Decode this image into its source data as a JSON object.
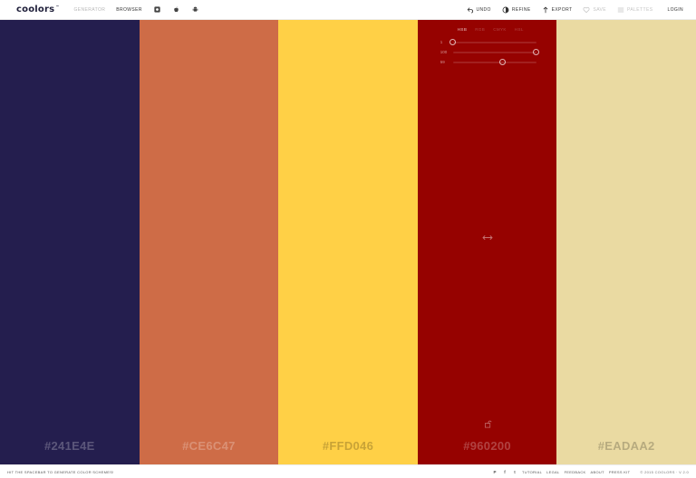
{
  "header": {
    "logo": "coolors",
    "logo_mark": "™",
    "nav": {
      "generator": "GENERATOR",
      "browser": "BROWSER"
    },
    "platform_icons": [
      "chrome-icon",
      "apple-icon",
      "android-icon"
    ],
    "actions": {
      "undo": "UNDO",
      "refine": "REFINE",
      "export": "EXPORT",
      "save": "SAVE",
      "palettes": "PALETTES",
      "login": "LOGIN"
    }
  },
  "palette": {
    "colors": [
      {
        "hex": "#241E4E",
        "label": "#241E4E"
      },
      {
        "hex": "#CE6C47",
        "label": "#CE6C47"
      },
      {
        "hex": "#FFD046",
        "label": "#FFD046"
      },
      {
        "hex": "#960200",
        "label": "#960200"
      },
      {
        "hex": "#EADAA2",
        "label": "#EADAA2"
      }
    ],
    "adjust_panel": {
      "modes": [
        "HSB",
        "RGB",
        "CMYK",
        "HSL"
      ],
      "active_mode": "HSB",
      "sliders": [
        {
          "label": "1",
          "fraction": 0.0
        },
        {
          "label": "100",
          "fraction": 1.0
        },
        {
          "label": "59",
          "fraction": 0.59
        }
      ]
    }
  },
  "footer": {
    "hint": "HIT THE SPACEBAR TO GENERATE COLOR SCHEMES!",
    "social": [
      "P",
      "f",
      "t"
    ],
    "links": {
      "tutorial": "TUTORIAL",
      "legal": "LEGAL",
      "feedback": "FEEDBACK",
      "about": "ABOUT",
      "press": "PRESS KIT"
    },
    "copyright": "© 2015 COOLORS · V 2.0"
  }
}
